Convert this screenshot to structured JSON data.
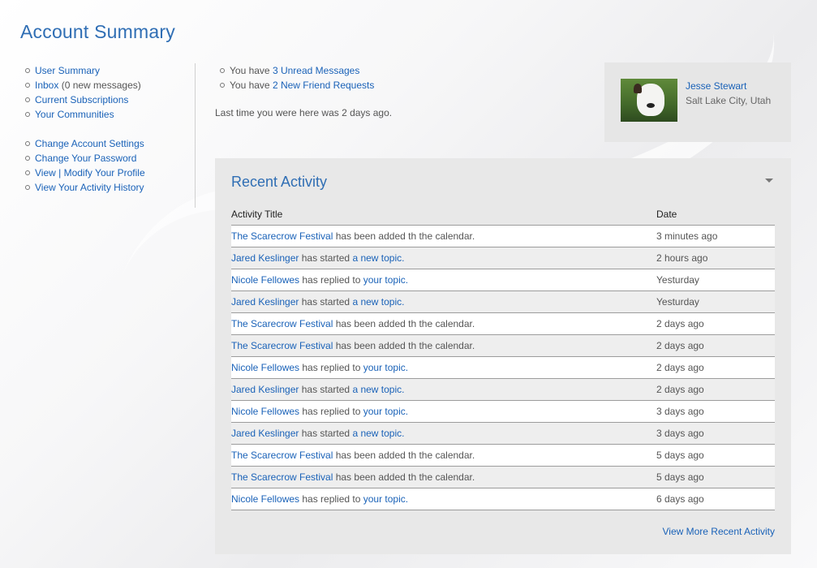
{
  "page": {
    "title": "Account Summary"
  },
  "nav": {
    "group1": [
      {
        "label": "User Summary"
      },
      {
        "label": "Inbox",
        "suffix": " (0 new messages)"
      },
      {
        "label": "Current Subscriptions"
      },
      {
        "label": "Your Communities"
      }
    ],
    "group2": [
      {
        "label": "Change Account Settings"
      },
      {
        "label": "Change Your Password"
      },
      {
        "label": "View | Modify Your Profile"
      },
      {
        "label": "View Your Activity History"
      }
    ]
  },
  "messages": {
    "unread": {
      "prefix": "You have ",
      "link": "3 Unread Messages"
    },
    "friends": {
      "prefix": "You have ",
      "link": "2 New Friend Requests"
    },
    "last_visit": "Last time you were here was 2 days ago."
  },
  "profile": {
    "name": "Jesse Stewart",
    "location": "Salt Lake City, Utah"
  },
  "activity": {
    "title": "Recent Activity",
    "columns": {
      "title": "Activity Title",
      "date": "Date"
    },
    "rows": [
      {
        "a": "The Scarecrow Festival",
        "mid": " has been added th the calendar.",
        "b": "",
        "date": "3 minutes ago"
      },
      {
        "a": "Jared Keslinger",
        "mid": " has started ",
        "b": "a new topic",
        "date": "2 hours ago"
      },
      {
        "a": "Nicole Fellowes",
        "mid": " has replied to ",
        "b": "your topic",
        "date": "Yesturday"
      },
      {
        "a": "Jared Keslinger",
        "mid": " has started ",
        "b": "a new topic",
        "date": "Yesturday"
      },
      {
        "a": "The Scarecrow Festival",
        "mid": " has been added th the calendar.",
        "b": "",
        "date": "2 days ago"
      },
      {
        "a": "The Scarecrow Festival",
        "mid": " has been added th the calendar.",
        "b": "",
        "date": "2 days ago"
      },
      {
        "a": "Nicole Fellowes",
        "mid": " has replied to ",
        "b": "your topic",
        "date": "2 days ago"
      },
      {
        "a": "Jared Keslinger",
        "mid": " has started ",
        "b": "a new topic",
        "date": "2 days ago"
      },
      {
        "a": "Nicole Fellowes",
        "mid": " has replied to ",
        "b": "your topic",
        "date": "3 days ago"
      },
      {
        "a": "Jared Keslinger",
        "mid": " has started ",
        "b": "a new topic",
        "date": "3 days ago"
      },
      {
        "a": "The Scarecrow Festival",
        "mid": " has been added th the calendar.",
        "b": "",
        "date": "5 days ago"
      },
      {
        "a": "The Scarecrow Festival",
        "mid": " has been added th the calendar.",
        "b": "",
        "date": "5 days ago"
      },
      {
        "a": "Nicole Fellowes",
        "mid": " has replied to ",
        "b": "your topic",
        "date": "6 days ago"
      }
    ],
    "view_more": "View More Recent Activity"
  }
}
